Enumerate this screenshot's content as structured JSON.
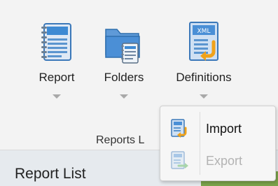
{
  "ribbon": {
    "buttons": [
      {
        "label": "Report",
        "icon": "report-document-icon"
      },
      {
        "label": "Folders",
        "icon": "folders-icon"
      },
      {
        "label": "Definitions",
        "icon": "xml-definitions-icon"
      }
    ],
    "group_label": "Reports L"
  },
  "definitions_menu": {
    "items": [
      {
        "label": "Import",
        "icon": "import-icon",
        "enabled": true
      },
      {
        "label": "Export",
        "icon": "export-icon",
        "enabled": false
      }
    ]
  },
  "panel": {
    "title": "Report List"
  },
  "colors": {
    "ribbon_bg": "#f3f3f3",
    "icon_blue": "#3e8ad3",
    "icon_orange": "#f0a21a",
    "panel_header_bg": "#e6eaee",
    "disabled_text": "#b3b3b3"
  }
}
